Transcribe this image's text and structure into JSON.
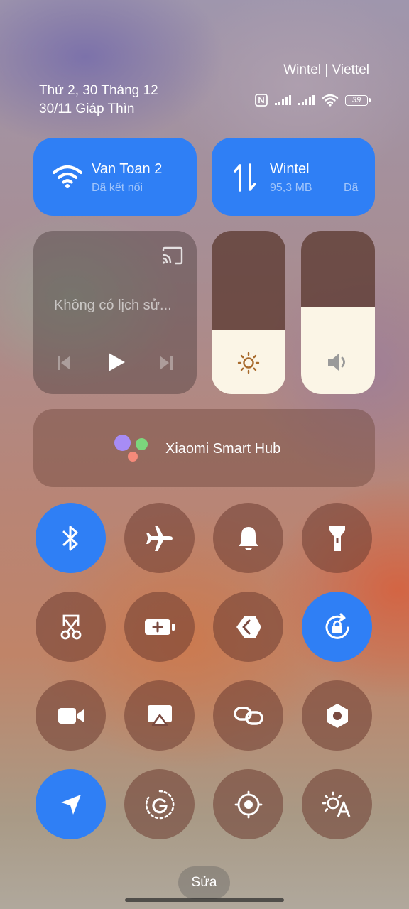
{
  "status": {
    "carrier": "Wintel | Viettel",
    "date_line1": "Thứ 2, 30 Tháng 12",
    "date_line2": "30/11 Giáp Thìn",
    "battery": "39",
    "icons": [
      "nfc-icon",
      "signal-icon",
      "signal-icon",
      "wifi-icon",
      "battery-icon"
    ]
  },
  "wifi_tile": {
    "title": "Van Toan 2",
    "subtitle": "Đã kết nối",
    "icon": "wifi-icon"
  },
  "data_tile": {
    "title": "Wintel",
    "subtitle": "95,3 MB",
    "subtitle_extra": "Đã",
    "icon": "mobile-data-icon"
  },
  "media": {
    "text": "Không có lịch sử...",
    "icons": [
      "cast-icon",
      "previous-icon",
      "play-icon",
      "next-icon"
    ]
  },
  "brightness": {
    "level": 0.39,
    "icon": "sun-icon"
  },
  "volume": {
    "level": 0.53,
    "icon": "speaker-icon"
  },
  "hub": {
    "label": "Xiaomi Smart Hub"
  },
  "toggles": [
    {
      "name": "bluetooth",
      "on": true
    },
    {
      "name": "airplane",
      "on": false
    },
    {
      "name": "silent",
      "on": false
    },
    {
      "name": "flashlight",
      "on": false
    },
    {
      "name": "screenshot",
      "on": false
    },
    {
      "name": "battery-saver",
      "on": false
    },
    {
      "name": "share",
      "on": false
    },
    {
      "name": "rotation-lock",
      "on": true
    },
    {
      "name": "screen-recorder",
      "on": false
    },
    {
      "name": "cast",
      "on": false
    },
    {
      "name": "link",
      "on": false
    },
    {
      "name": "settings",
      "on": false
    },
    {
      "name": "location",
      "on": true
    },
    {
      "name": "google",
      "on": false
    },
    {
      "name": "focus",
      "on": false
    },
    {
      "name": "auto-brightness",
      "on": false
    }
  ],
  "edit_label": "Sửa",
  "colors": {
    "accent": "#2f7ff5",
    "slider_fill": "#fbf5e6"
  }
}
